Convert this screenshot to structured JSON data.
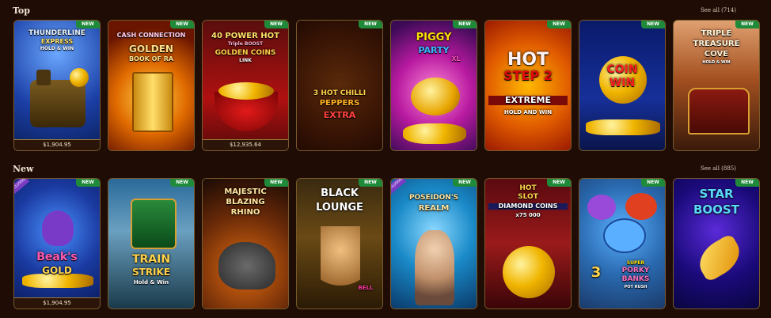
{
  "sections": {
    "top": {
      "title": "Top",
      "see_all": "See all (714)",
      "games": [
        {
          "line1": "THUNDERLINE",
          "line2": "EXPRESS",
          "line3": "HOLD & WIN",
          "badge": "NEW",
          "jackpot": "$1,904.95"
        },
        {
          "line1": "CASH CONNECTION",
          "line2": "GOLDEN",
          "line3": "BOOK OF RA",
          "badge": "NEW"
        },
        {
          "line1": "40 POWER HOT",
          "line2": "Triple BOOST",
          "line3": "GOLDEN COINS",
          "line4": "LINK",
          "badge": "NEW",
          "jackpot": "$12,935.64"
        },
        {
          "line1": "3 HOT CHILLI",
          "line2": "PEPPERS",
          "line3": "EXTRA",
          "badge": "NEW"
        },
        {
          "line1": "PIGGY",
          "line2": "PARTY",
          "line3": "XL",
          "badge": "NEW"
        },
        {
          "line1": "HOT",
          "line2": "STEP 2",
          "line3": "EXTREME",
          "line4": "HOLD AND WIN",
          "badge": "NEW"
        },
        {
          "line1": "COIN",
          "line2": "WIN",
          "badge": "NEW"
        },
        {
          "line1": "TRIPLE",
          "line2": "TREASURE",
          "line3": "COVE",
          "line4": "HOLD & WIN",
          "badge": "NEW"
        }
      ]
    },
    "new": {
      "title": "New",
      "see_all": "See all (885)",
      "games": [
        {
          "line1": "Beak's",
          "line2": "GOLD",
          "badge": "NEW",
          "exclusive": "EXCLUSIVE",
          "jackpot": "$1,904.95"
        },
        {
          "line1": "TRAIN",
          "line2": "STRIKE",
          "line3": "Hold & Win",
          "badge": "NEW"
        },
        {
          "line1": "MAJESTIC",
          "line2": "BLAZING",
          "line3": "RHINO",
          "badge": "NEW"
        },
        {
          "line1": "BLACK",
          "line2": "LOUNGE",
          "badge": "NEW",
          "corner": "BELL"
        },
        {
          "line1": "POSEIDON'S",
          "line2": "REALM",
          "badge": "NEW",
          "exclusive": "EXCLUSIVE"
        },
        {
          "line1": "HOT",
          "line2": "SLOT",
          "line3": "DIAMOND COINS",
          "line4": "x75 000",
          "badge": "NEW"
        },
        {
          "line1": "3",
          "line2": "SUPER",
          "line3": "PORKY",
          "line4": "BANKS",
          "line5": "POT RUSH",
          "badge": "NEW"
        },
        {
          "line1": "STAR",
          "line2": "BOOST",
          "badge": "NEW"
        }
      ]
    }
  },
  "colors": {
    "background": "#1f0d05",
    "new_badge": "#1f8a3a",
    "exclusive_badge": "#7b3cc4"
  }
}
